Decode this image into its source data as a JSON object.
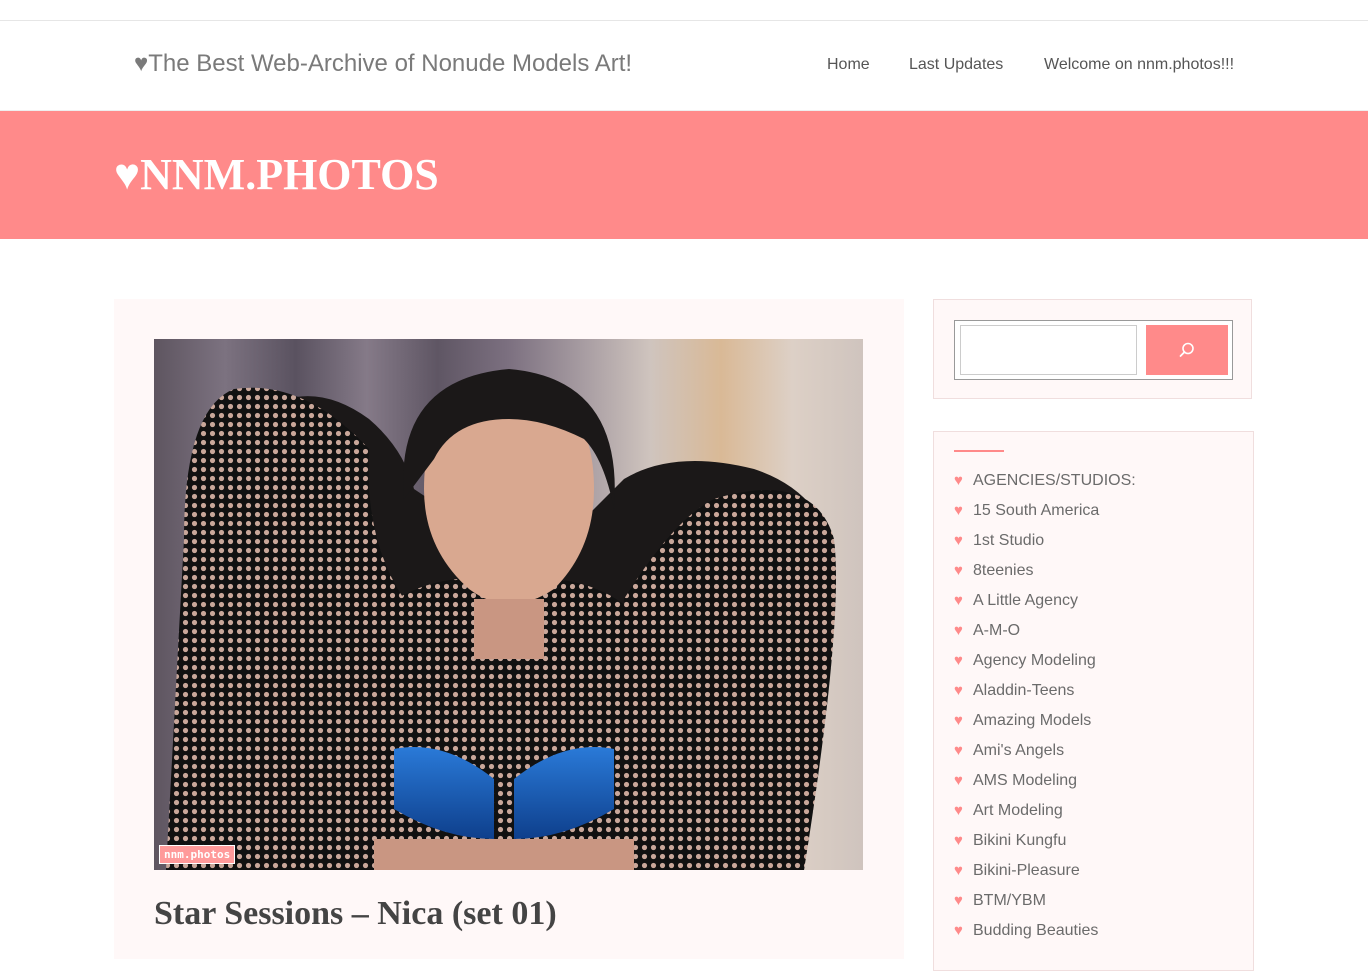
{
  "header": {
    "tagline": "♥The Best Web-Archive of Nonude Models Art!",
    "nav": [
      {
        "label": "Home"
      },
      {
        "label": "Last Updates"
      },
      {
        "label": "Welcome on nnm.photos!!!"
      }
    ]
  },
  "banner": {
    "title": "♥NNM.PHOTOS"
  },
  "post": {
    "title": "Star Sessions – Nica (set 01)",
    "watermark": "nnm.photos"
  },
  "search": {
    "placeholder": "",
    "icon": "search-icon"
  },
  "categories": {
    "bullet": "♥",
    "items": [
      "AGENCIES/STUDIOS:",
      "15 South America",
      "1st Studio",
      "8teenies",
      "A Little Agency",
      "A-M-O",
      "Agency Modeling",
      "Aladdin-Teens",
      "Amazing Models",
      "Ami's Angels",
      "AMS Modeling",
      "Art Modeling",
      "Bikini Kungfu",
      "Bikini-Pleasure",
      "BTM/YBM",
      "Budding Beauties"
    ]
  },
  "colors": {
    "accent": "#ff8a8a",
    "accent_light": "#ff9a9a",
    "card_bg": "#fff8f8"
  }
}
